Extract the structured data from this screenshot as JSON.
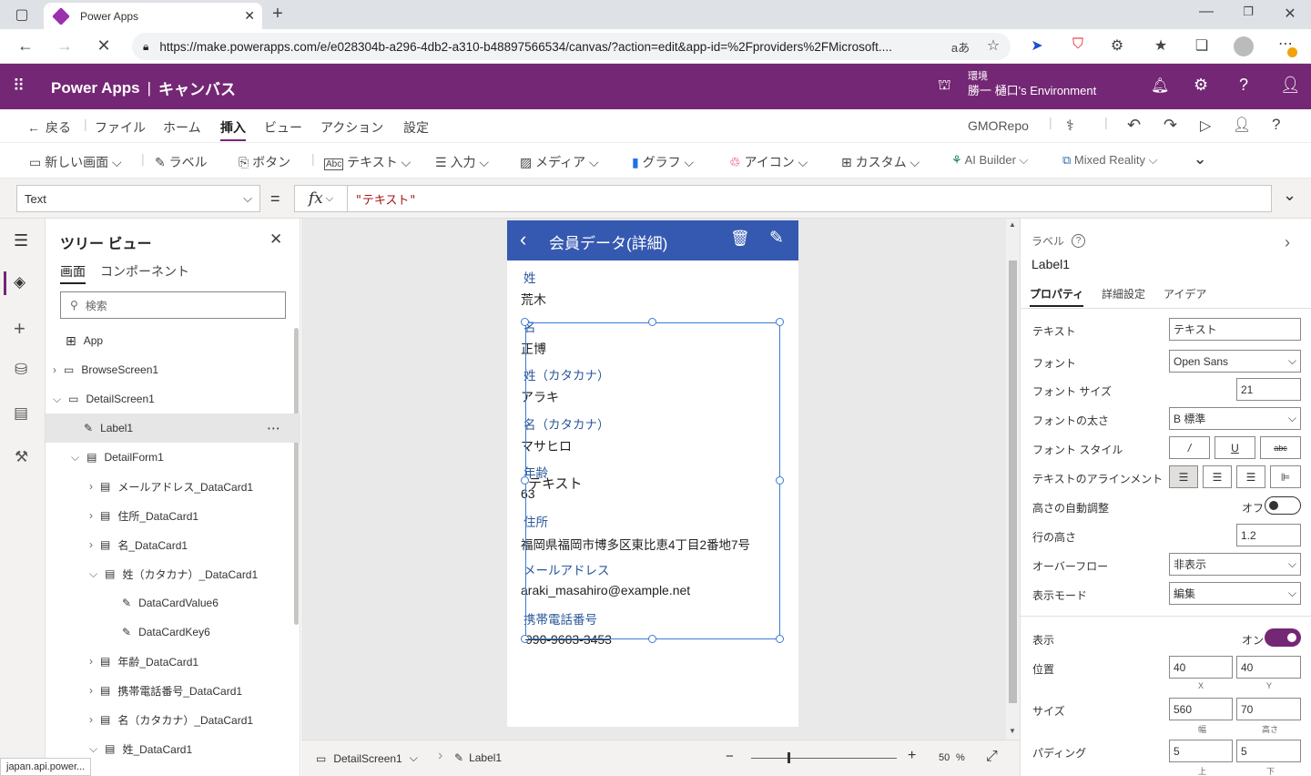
{
  "browser": {
    "tab_title": "Power Apps",
    "url": "https://make.powerapps.com/e/e028304b-a296-4db2-a310-b48897566534/canvas/?action=edit&app-id=%2Fproviders%2FMicrosoft....",
    "status_url": "japan.api.power..."
  },
  "header": {
    "product": "Power Apps",
    "separator": "|",
    "mode": "キャンバス",
    "env_label": "環境",
    "env_name": "勝一 樋口's Environment"
  },
  "menu": {
    "back": "戻る",
    "items": [
      "ファイル",
      "ホーム",
      "挿入",
      "ビュー",
      "アクション",
      "設定"
    ],
    "active": "挿入",
    "app_name": "GMORepo"
  },
  "ribbon": {
    "new_screen": "新しい画面",
    "label": "ラベル",
    "button": "ボタン",
    "text": "テキスト",
    "input": "入力",
    "media": "メディア",
    "chart": "グラフ",
    "icon": "アイコン",
    "custom": "カスタム",
    "ai_builder": "AI Builder",
    "mixed_reality": "Mixed Reality"
  },
  "formula": {
    "property": "Text",
    "equals": "=",
    "fx": "fx",
    "value": "\"テキスト\""
  },
  "tree": {
    "title": "ツリー ビュー",
    "tab_screens": "画面",
    "tab_components": "コンポーネント",
    "search_placeholder": "検索",
    "items": [
      {
        "label": "App"
      },
      {
        "label": "BrowseScreen1"
      },
      {
        "label": "DetailScreen1"
      },
      {
        "label": "Label1"
      },
      {
        "label": "DetailForm1"
      },
      {
        "label": "メールアドレス_DataCard1"
      },
      {
        "label": "住所_DataCard1"
      },
      {
        "label": "名_DataCard1"
      },
      {
        "label": "姓（カタカナ）_DataCard1"
      },
      {
        "label": "DataCardValue6"
      },
      {
        "label": "DataCardKey6"
      },
      {
        "label": "年齢_DataCard1"
      },
      {
        "label": "携帯電話番号_DataCard1"
      },
      {
        "label": "名（カタカナ）_DataCard1"
      },
      {
        "label": "姓_DataCard1"
      }
    ]
  },
  "screen": {
    "title": "会員データ(詳細)",
    "fields": [
      {
        "label": "姓",
        "value": "荒木"
      },
      {
        "label": "名",
        "value": "正博"
      },
      {
        "label": "姓（カタカナ）",
        "value": "アラキ"
      },
      {
        "label": "名（カタカナ）",
        "value": "マサヒロ"
      },
      {
        "label": "年齢",
        "value": "63"
      },
      {
        "label": "住所",
        "value": "福岡県福岡市博多区東比恵4丁目2番地7号"
      },
      {
        "label": "メールアドレス",
        "value": "araki_masahiro@example.net"
      },
      {
        "label": "携帯電話番号",
        "value": "090-9603-3453"
      }
    ],
    "label_text": "テキスト"
  },
  "status": {
    "screen": "DetailScreen1",
    "control": "Label1",
    "zoom": "50",
    "zoom_unit": "%"
  },
  "props": {
    "type": "ラベル",
    "name": "Label1",
    "tabs": [
      "プロパティ",
      "詳細設定",
      "アイデア"
    ],
    "text_label": "テキスト",
    "text_value": "テキスト",
    "font_label": "フォント",
    "font_value": "Open Sans",
    "fontsize_label": "フォント サイズ",
    "fontsize_value": "21",
    "fontweight_label": "フォントの太さ",
    "fontweight_value": "B 標準",
    "fontstyle_label": "フォント スタイル",
    "fontstyle_italic": "/",
    "fontstyle_underline": "U",
    "fontstyle_strike": "abc",
    "align_label": "テキストのアラインメント",
    "autoheight_label": "高さの自動調整",
    "autoheight_value": "オフ",
    "lineheight_label": "行の高さ",
    "lineheight_value": "1.2",
    "overflow_label": "オーバーフロー",
    "overflow_value": "非表示",
    "displaymode_label": "表示モード",
    "displaymode_value": "編集",
    "visible_label": "表示",
    "visible_value": "オン",
    "position_label": "位置",
    "position_x": "40",
    "position_y": "40",
    "x_label": "X",
    "y_label": "Y",
    "size_label": "サイズ",
    "size_w": "560",
    "size_h": "70",
    "w_label": "幅",
    "h_label": "高さ",
    "padding_label": "パディング",
    "padding_top": "5",
    "padding_bottom": "5",
    "top_label": "上",
    "bottom_label": "下"
  }
}
